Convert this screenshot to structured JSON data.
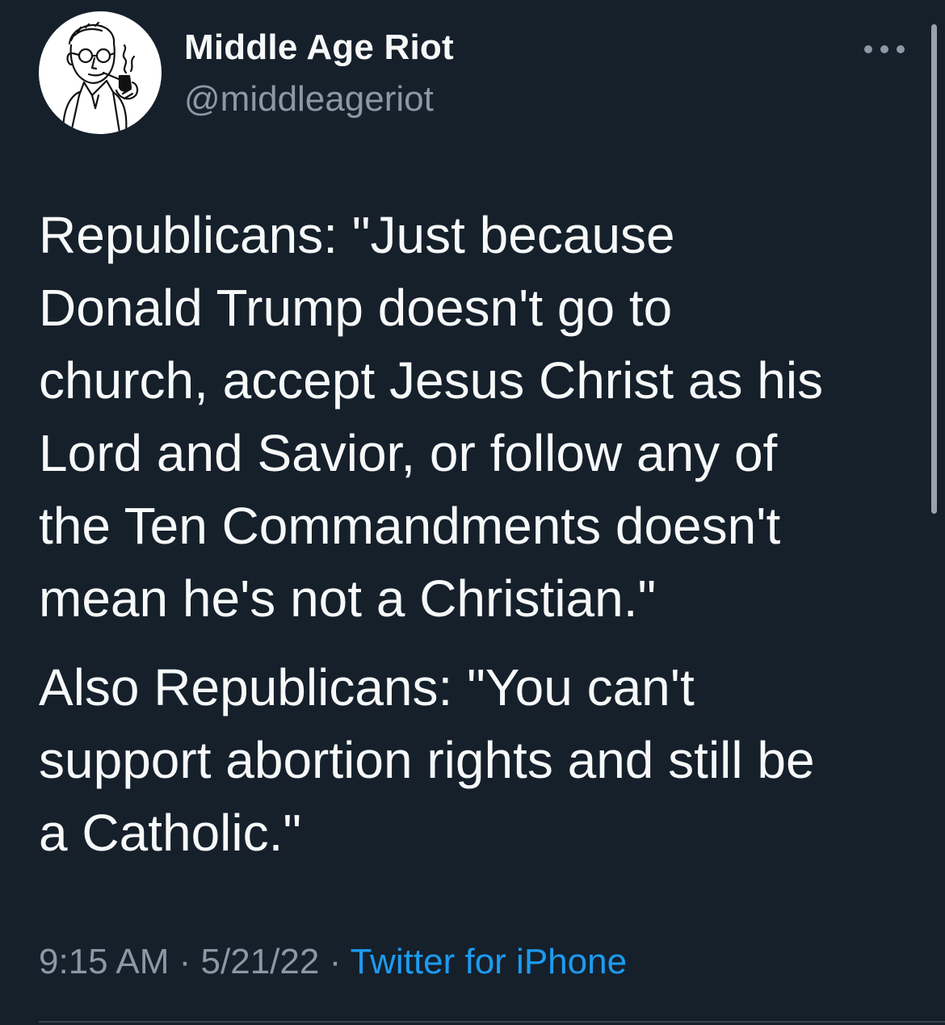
{
  "author": {
    "display_name": "Middle Age Riot",
    "handle": "@middleageriot"
  },
  "tweet": {
    "paragraphs": [
      "Republicans: \"Just because\nDonald Trump doesn't go to\nchurch, accept Jesus Christ as his\nLord and Savior, or follow any of\nthe Ten Commandments doesn't\nmean he's not a Christian.\"",
      "Also Republicans: \"You can't\nsupport abortion rights and still be\na Catholic.\""
    ],
    "time": "9:15 AM",
    "separator": " · ",
    "date": "5/21/22",
    "source": "Twitter for iPhone"
  },
  "icons": {
    "more": "more-options-icon",
    "avatar": "avatar-illustration-man-with-pipe"
  },
  "colors": {
    "background": "#15202b",
    "primary_text": "#f7f9f9",
    "secondary_text": "#8b98a5",
    "link": "#1d9bf0"
  }
}
